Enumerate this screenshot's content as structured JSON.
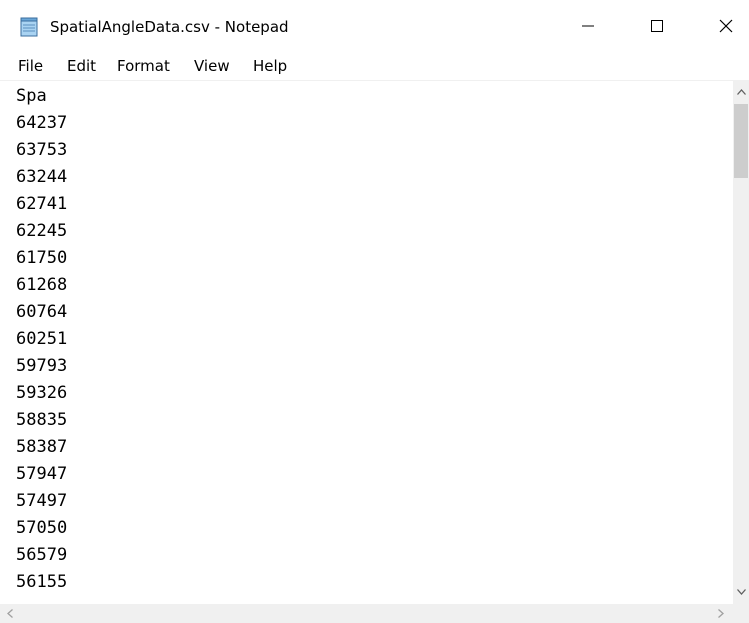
{
  "window": {
    "title": "SpatialAngleData.csv - Notepad",
    "icon": "notepad-icon"
  },
  "controls": {
    "minimize_icon": "minimize-icon",
    "maximize_icon": "maximize-icon",
    "close_icon": "close-icon"
  },
  "menu": {
    "items": [
      "File",
      "Edit",
      "Format",
      "View",
      "Help"
    ]
  },
  "document": {
    "lines": [
      "Spa",
      "64237",
      "63753",
      "63244",
      "62741",
      "62245",
      "61750",
      "61268",
      "60764",
      "60251",
      "59793",
      "59326",
      "58835",
      "58387",
      "57947",
      "57497",
      "57050",
      "56579",
      "56155"
    ]
  },
  "scrollbars": {
    "vertical": {
      "up_icon": "chevron-up-icon",
      "down_icon": "chevron-down-icon"
    },
    "horizontal": {
      "left_icon": "chevron-left-icon",
      "right_icon": "chevron-right-icon"
    }
  }
}
